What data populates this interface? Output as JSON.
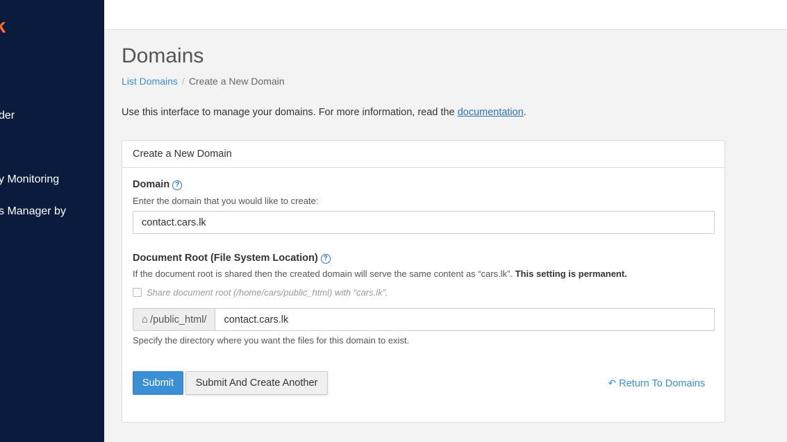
{
  "sidebar": {
    "logo": "ter.lk",
    "items": [
      {
        "label": "der"
      },
      {
        "label": "y Monitoring"
      },
      {
        "label": "s Manager by"
      }
    ]
  },
  "page": {
    "title": "Domains",
    "breadcrumb": {
      "link": "List Domains",
      "separator": "/",
      "current": "Create a New Domain"
    },
    "intro_text": "Use this interface to manage your domains. For more information, read the ",
    "intro_link": "documentation",
    "intro_end": "."
  },
  "panel": {
    "header": "Create a New Domain",
    "domain": {
      "label": "Domain",
      "hint": "Enter the domain that you would like to create:",
      "value": "contact.cars.lk"
    },
    "docroot": {
      "label": "Document Root (File System Location)",
      "hint_text": "If the document root is shared then the created domain will serve the same content as “cars.lk”. ",
      "hint_bold": "This setting is permanent.",
      "share_label": "Share document root (/home/cars/public_html) with “cars.lk”.",
      "share_checked": false,
      "prefix": "/public_html/",
      "value": "contact.cars.lk",
      "help_text": "Specify the directory where you want the files for this domain to exist."
    },
    "buttons": {
      "submit": "Submit",
      "submit_another": "Submit And Create Another",
      "return": "Return To Domains"
    }
  },
  "icons": {
    "help": "question-circle-icon",
    "home": "home-icon",
    "return": "reply-arrow-icon"
  },
  "colors": {
    "sidebar_bg": "#0a1b3d",
    "logo": "#ff6c2c",
    "primary": "#3a8fd5",
    "link": "#3b8ed4"
  }
}
